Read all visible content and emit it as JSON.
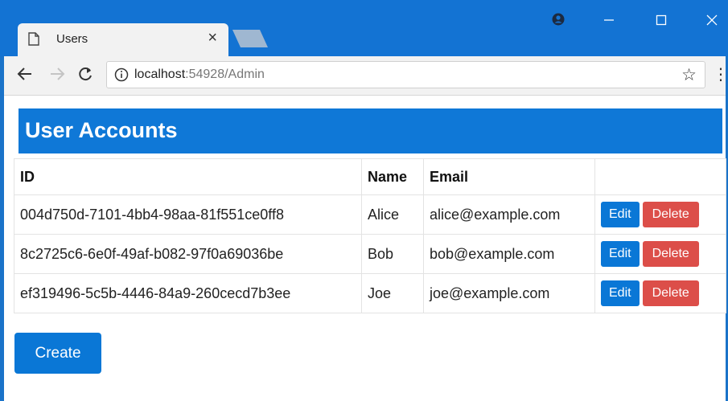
{
  "browser": {
    "tab_title": "Users",
    "tab_close": "×",
    "url_host": "localhost",
    "url_rest": ":54928/Admin",
    "accent_color": "#1373d3",
    "icons": [
      "page-icon",
      "profile-icon",
      "minimize-icon",
      "maximize-icon",
      "close-icon",
      "back-arrow-icon",
      "forward-arrow-icon",
      "reload-icon",
      "info-icon",
      "star-icon",
      "menu-icon"
    ]
  },
  "page": {
    "heading": "User Accounts",
    "columns": {
      "id": "ID",
      "name": "Name",
      "email": "Email"
    },
    "users": [
      {
        "id": "004d750d-7101-4bb4-98aa-81f551ce0ff8",
        "name": "Alice",
        "email": "alice@example.com"
      },
      {
        "id": "8c2725c6-6e0f-49af-b082-97f0a69036be",
        "name": "Bob",
        "email": "bob@example.com"
      },
      {
        "id": "ef319496-5c5b-4446-84a9-260cecd7b3ee",
        "name": "Joe",
        "email": "joe@example.com"
      }
    ],
    "edit_label": "Edit",
    "delete_label": "Delete",
    "create_label": "Create",
    "primary_color": "#0a77d6",
    "danger_color": "#dc4e49"
  }
}
